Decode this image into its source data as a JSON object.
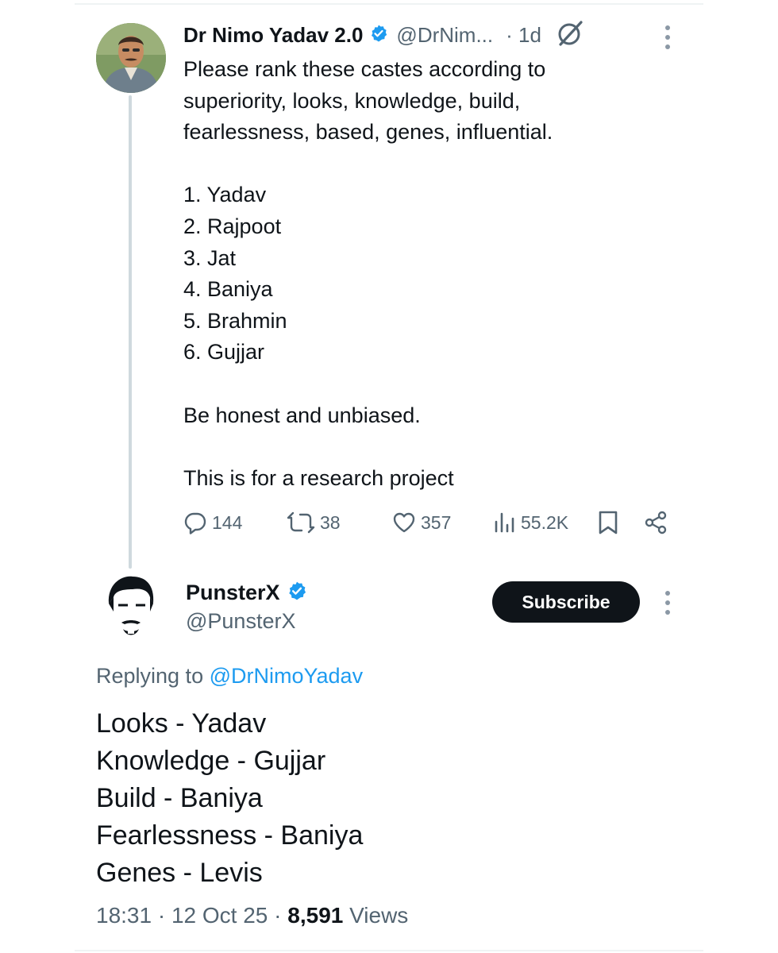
{
  "tweet": {
    "author_name": "Dr Nimo Yadav 2.0",
    "handle": "@DrNim...",
    "time": "· 1d",
    "body_lines": [
      "Please rank these castes according to",
      "superiority, looks, knowledge, build,",
      "fearlessness, based, genes, influential.",
      "",
      "1. Yadav",
      "2. Rajpoot",
      "3. Jat",
      "4. Baniya",
      "5. Brahmin",
      "6. Gujjar",
      "",
      "Be honest and unbiased.",
      "",
      "This is for a research project"
    ],
    "actions": {
      "replies": "144",
      "reposts": "38",
      "likes": "357",
      "views": "55.2K"
    },
    "icons": [
      "verified-badge-icon",
      "grok-icon",
      "more-icon",
      "reply-icon",
      "repost-icon",
      "like-icon",
      "views-icon",
      "bookmark-icon",
      "share-icon"
    ]
  },
  "reply": {
    "author_name": "PunsterX",
    "handle": "@PunsterX",
    "subscribe_label": "Subscribe",
    "replying_prefix": "Replying to",
    "replying_handle": "@DrNimoYadav",
    "body_lines": [
      "Looks - Yadav",
      "Knowledge - Gujjar",
      "Build - Baniya",
      "Fearlessness - Baniya",
      "Genes - Levis"
    ],
    "time": "18:31",
    "date": "12 Oct 25",
    "views_count": "8,591",
    "views_label": "Views"
  },
  "colors": {
    "text": "#0f1419",
    "muted": "#536471",
    "link": "#1d9bf0",
    "verified": "#1d9bf0",
    "thread_line": "#cfd9de",
    "button_bg": "#0f1419"
  }
}
